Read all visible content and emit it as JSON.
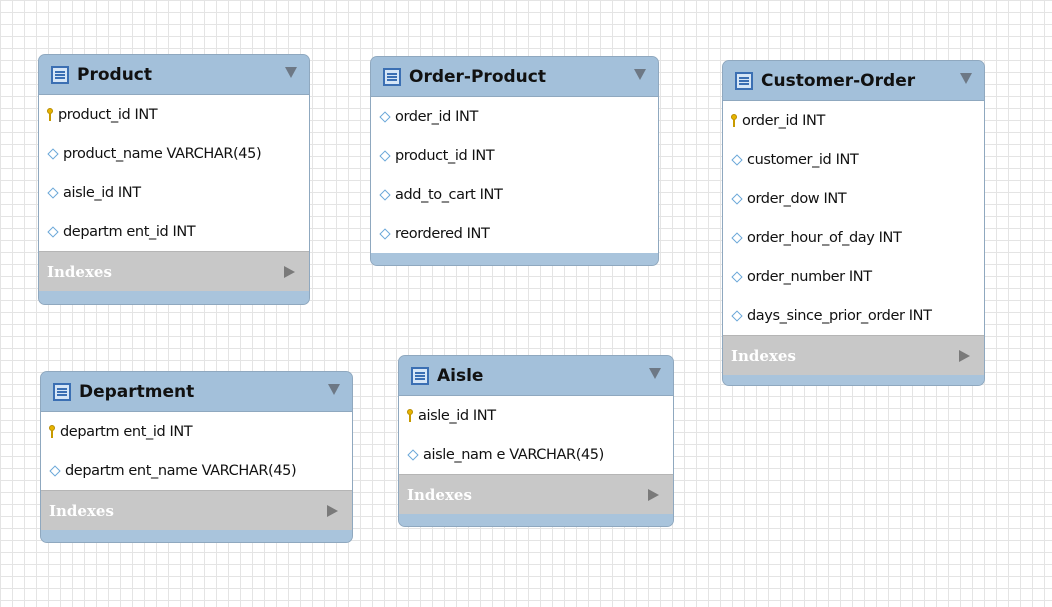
{
  "tables": {
    "product": {
      "title": "Product",
      "columns": [
        "product_id INT",
        "product_name VARCHAR(45)",
        "aisle_id INT",
        "departm ent_id INT"
      ],
      "indexes": "Indexes"
    },
    "order_product": {
      "title": "Order-Product",
      "columns": [
        "order_id INT",
        "product_id INT",
        "add_to_cart INT",
        "reordered INT"
      ]
    },
    "customer_order": {
      "title": "Customer-Order",
      "columns": [
        "order_id INT",
        "customer_id INT",
        "order_dow INT",
        "order_hour_of_day INT",
        "order_number INT",
        "days_since_prior_order INT"
      ],
      "indexes": "Indexes"
    },
    "department": {
      "title": "Department",
      "columns": [
        "departm ent_id INT",
        "departm ent_name VARCHAR(45)"
      ],
      "indexes": "Indexes"
    },
    "aisle": {
      "title": "Aisle",
      "columns": [
        "aisle_id INT",
        "aisle_nam e VARCHAR(45)"
      ],
      "indexes": "Indexes"
    }
  },
  "icons": {
    "table": "table-icon",
    "primary_key": "key-icon",
    "column": "diamond-icon",
    "collapse": "triangle-down-icon",
    "expand": "triangle-right-icon"
  },
  "colors": {
    "header": "#a3c0da",
    "indexes_bar": "#c8c8c8",
    "key": "#e7b400",
    "column_diamond": "#6aa7d8"
  }
}
